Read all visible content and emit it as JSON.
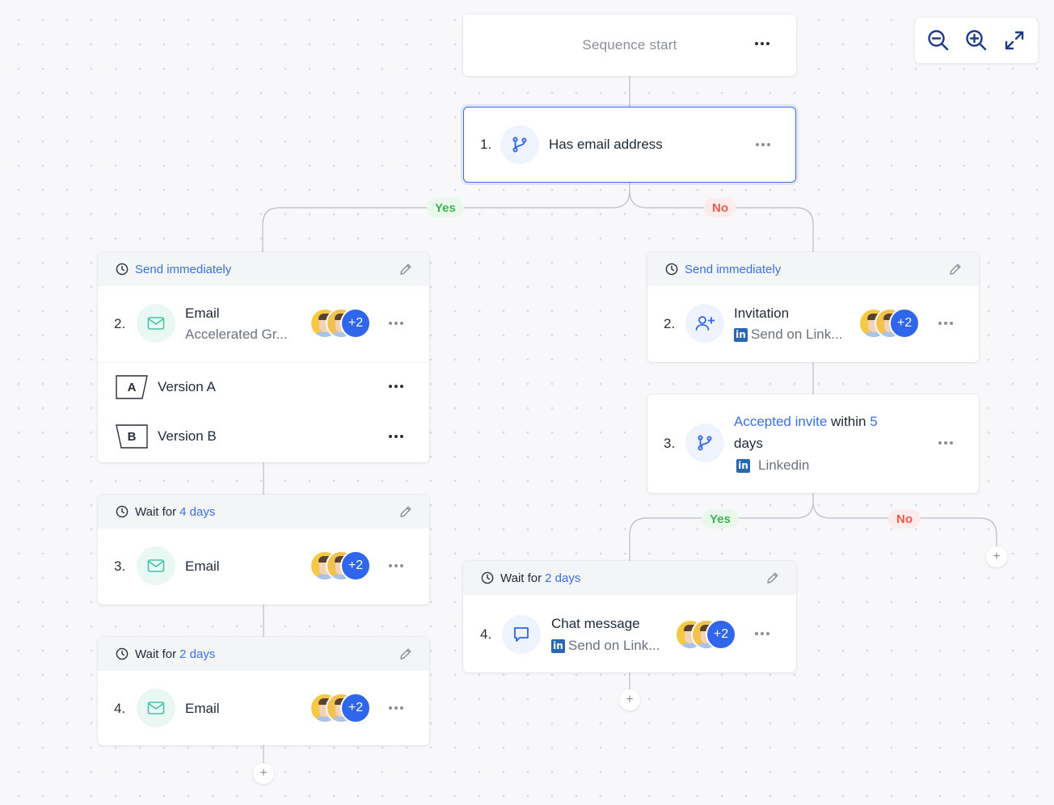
{
  "zoom": {
    "zoom_out_icon": "zoom-out-icon",
    "zoom_in_icon": "zoom-in-icon",
    "fit_icon": "expand-icon"
  },
  "start": {
    "label": "Sequence start"
  },
  "condition1": {
    "number": "1.",
    "title": "Has email address",
    "icon": "branch-icon"
  },
  "branches": {
    "yes": "Yes",
    "no": "No",
    "yes2": "Yes",
    "no2": "No"
  },
  "left": {
    "step2": {
      "header": "Send immediately",
      "number": "2.",
      "title": "Email",
      "subtitle": "Accelerated Gr...",
      "plus_count": "+2",
      "versions": [
        {
          "badge": "A",
          "label": "Version A"
        },
        {
          "badge": "B",
          "label": "Version B"
        }
      ]
    },
    "step3": {
      "header_prefix": "Wait for",
      "header_value": "4 days",
      "number": "3.",
      "title": "Email",
      "plus_count": "+2"
    },
    "step4": {
      "header_prefix": "Wait for",
      "header_value": "2 days",
      "number": "4.",
      "title": "Email",
      "plus_count": "+2"
    }
  },
  "right": {
    "step2": {
      "header": "Send immediately",
      "number": "2.",
      "title": "Invitation",
      "subtitle": "Send on Link...",
      "plus_count": "+2"
    },
    "step3": {
      "number": "3.",
      "title_link": "Accepted invite",
      "title_mid": "within",
      "title_value": "5",
      "title_end": "days",
      "subtitle": "Linkedin"
    },
    "step4": {
      "header_prefix": "Wait for",
      "header_value": "2 days",
      "number": "4.",
      "title": "Chat message",
      "subtitle": "Send on Link...",
      "plus_count": "+2"
    }
  },
  "add_label": "+",
  "linkedin_glyph": "in"
}
